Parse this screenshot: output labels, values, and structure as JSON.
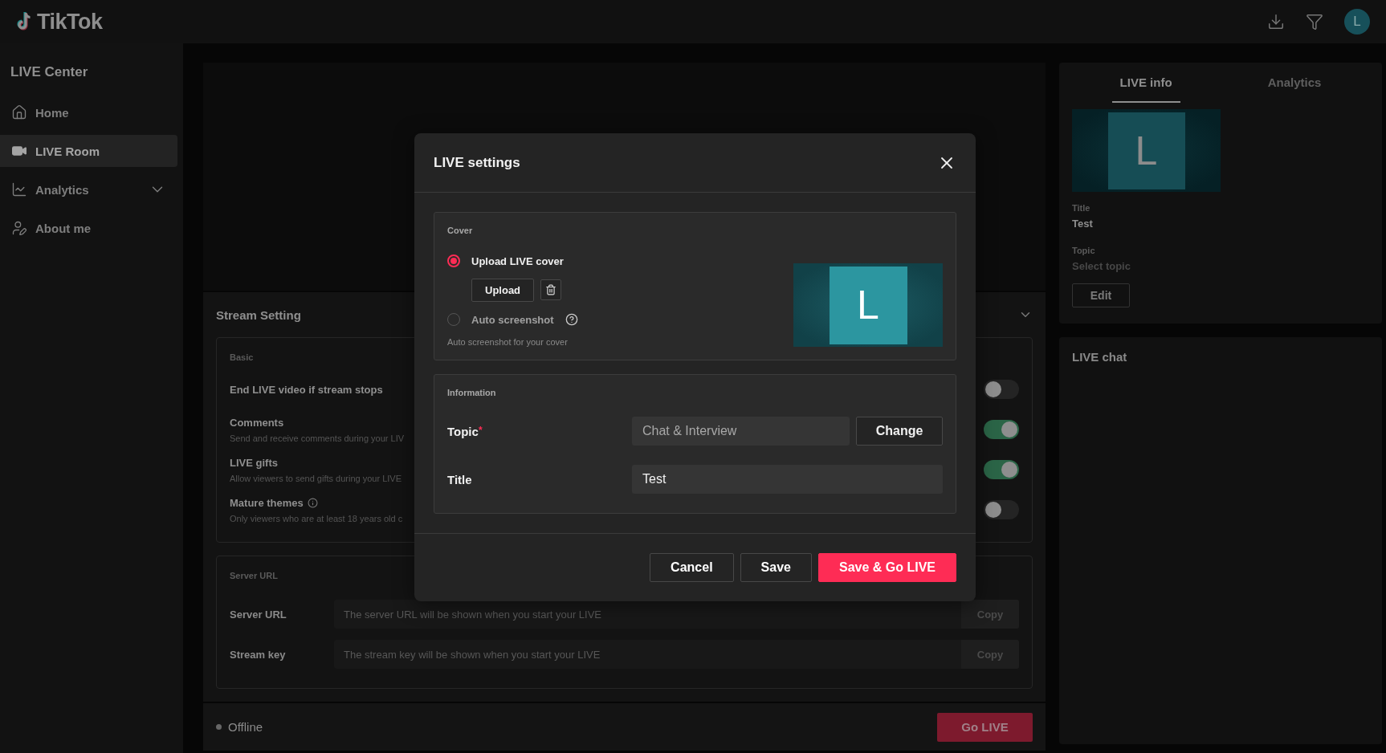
{
  "header": {
    "logo": "TikTok",
    "avatar_initial": "L"
  },
  "sidebar": {
    "title": "LIVE Center",
    "items": [
      {
        "label": "Home",
        "kind": "home",
        "selected": false
      },
      {
        "label": "LIVE Room",
        "kind": "video",
        "selected": true
      },
      {
        "label": "Analytics",
        "kind": "chart",
        "selected": false,
        "expanded": false
      },
      {
        "label": "About me",
        "kind": "profile",
        "selected": false
      }
    ]
  },
  "stream_setting": {
    "title": "Stream Setting",
    "expanded": true,
    "basic": {
      "label": "Basic",
      "options": [
        {
          "label": "End LIVE video if stream stops",
          "info": false,
          "on": false
        },
        {
          "label": "Comments",
          "description": "Send and receive comments during your LIV",
          "info": false,
          "on": true
        },
        {
          "label": "LIVE gifts",
          "description": "Allow viewers to send gifts during your LIVE",
          "info": false,
          "on": true
        },
        {
          "label": "Mature themes",
          "description": "Only viewers who are at least 18 years old c",
          "info": true,
          "on": false
        }
      ]
    },
    "server": {
      "label": "Server URL",
      "rows": [
        {
          "label": "Server URL",
          "placeholder": "The server URL will be shown when you start your LIVE",
          "button": "Copy"
        },
        {
          "label": "Stream key",
          "placeholder": "The stream key will be shown when you start your LIVE",
          "button": "Copy"
        }
      ]
    }
  },
  "status": {
    "label": "Offline",
    "live": false,
    "button": "Go LIVE"
  },
  "right_panel": {
    "tabs": [
      {
        "label": "LIVE info",
        "selected": true
      },
      {
        "label": "Analytics",
        "selected": false
      }
    ],
    "cover_initial": "L",
    "fields": [
      {
        "label": "Title",
        "value": "Test"
      },
      {
        "label": "Topic",
        "placeholder": "Select topic"
      }
    ],
    "edit_button": "Edit",
    "chat_title": "LIVE chat"
  },
  "modal": {
    "title": "LIVE settings",
    "cover": {
      "label": "Cover",
      "preview_initial": "L",
      "options": [
        {
          "kind": "upload",
          "label": "Upload LIVE cover",
          "selected": true,
          "button": "Upload"
        },
        {
          "kind": "auto",
          "label": "Auto screenshot",
          "selected": false,
          "description": "Auto screenshot for your cover"
        }
      ]
    },
    "information": {
      "label": "Information",
      "rows": [
        {
          "label": "Topic",
          "required_mark": "*",
          "value": "Chat & Interview",
          "button": "Change"
        },
        {
          "label": "Title",
          "value": "Test"
        }
      ]
    },
    "buttons": [
      {
        "label": "Cancel",
        "kind": "secondary"
      },
      {
        "label": "Save",
        "kind": "secondary"
      },
      {
        "label": "Save & Go LIVE",
        "kind": "primary"
      }
    ]
  }
}
